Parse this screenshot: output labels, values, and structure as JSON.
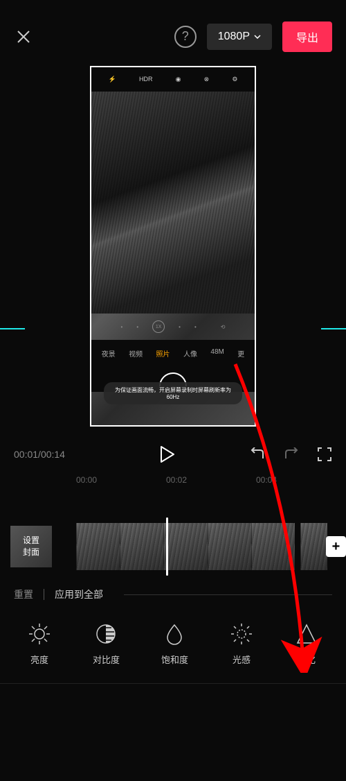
{
  "topBar": {
    "resolution": "1080P",
    "exportLabel": "导出",
    "helpSymbol": "?"
  },
  "preview": {
    "phoneTopIcons": [
      "⚡",
      "HDR",
      "◉",
      "⊗",
      "⚙"
    ],
    "zoomLabel": "1X",
    "modes": [
      "夜景",
      "视频",
      "照片",
      "人像",
      "48M",
      "更"
    ],
    "activeModeIndex": 2,
    "toastText": "为保证画面流畅，开启屏幕录制时屏幕刷新率为60Hz"
  },
  "playback": {
    "currentTime": "00:01",
    "totalTime": "00:14"
  },
  "timeline": {
    "marks": [
      "00:00",
      "00:02",
      "00:04"
    ],
    "coverLabel1": "设置",
    "coverLabel2": "封面",
    "addSymbol": "+"
  },
  "resetBar": {
    "resetLabel": "重置",
    "applyAllLabel": "应用到全部"
  },
  "tools": [
    {
      "name": "brightness",
      "label": "亮度"
    },
    {
      "name": "contrast",
      "label": "对比度"
    },
    {
      "name": "saturation",
      "label": "饱和度"
    },
    {
      "name": "light-sense",
      "label": "光感"
    },
    {
      "name": "sharpen",
      "label": "锐化"
    }
  ]
}
